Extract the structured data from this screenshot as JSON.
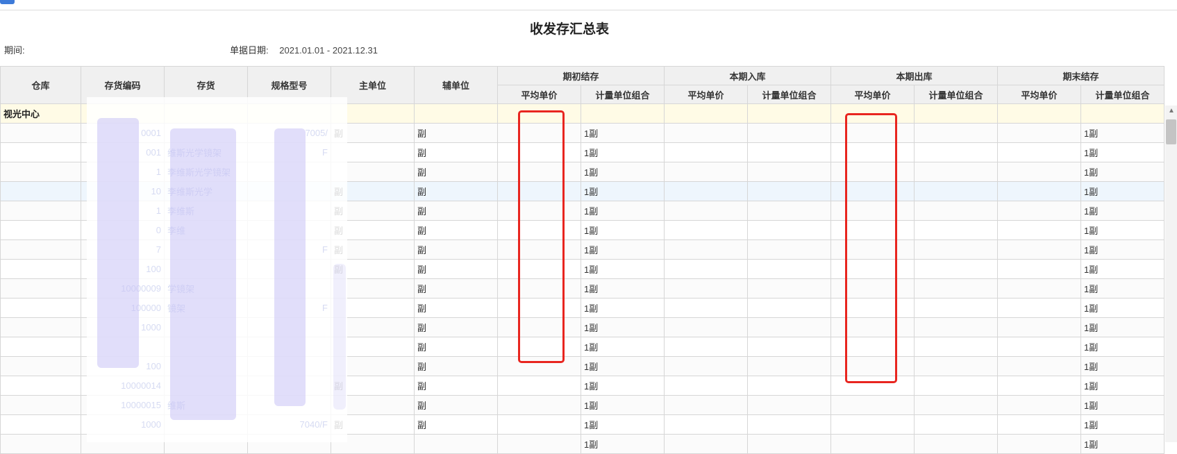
{
  "report": {
    "title": "收发存汇总表",
    "period_label": "期间:",
    "period_value": "",
    "date_label": "单据日期:",
    "date_value": "2021.01.01 - 2021.12.31"
  },
  "columns": {
    "warehouse": "仓库",
    "code": "存货编码",
    "item": "存货",
    "spec": "规格型号",
    "main_unit": "主单位",
    "aux_unit": "辅单位",
    "opening": "期初结存",
    "inbound": "本期入库",
    "outbound": "本期出库",
    "closing": "期末结存",
    "avg_price": "平均单价",
    "unit_combo": "计量单位组合"
  },
  "group_label": "视光中心",
  "rows": [
    {
      "code": "0001",
      "item": "",
      "spec": "7005/",
      "main": "副",
      "aux": "副",
      "open_combo": "1副",
      "close_combo": "1副"
    },
    {
      "code": "001",
      "item": "维斯光学镜架",
      "spec": "F",
      "main": "",
      "aux": "副",
      "open_combo": "1副",
      "close_combo": "1副"
    },
    {
      "code": "1",
      "item": "李维斯光学镜架",
      "spec": "",
      "main": "",
      "aux": "副",
      "open_combo": "1副",
      "close_combo": "1副"
    },
    {
      "code": "10",
      "item": "李维斯光学",
      "spec": "",
      "main": "副",
      "aux": "副",
      "open_combo": "1副",
      "close_combo": "1副"
    },
    {
      "code": "1",
      "item": "李维斯",
      "spec": "",
      "main": "副",
      "aux": "副",
      "open_combo": "1副",
      "close_combo": "1副"
    },
    {
      "code": "0",
      "item": "李维",
      "spec": "",
      "main": "副",
      "aux": "副",
      "open_combo": "1副",
      "close_combo": "1副"
    },
    {
      "code": "7",
      "item": "",
      "spec": "F",
      "main": "副",
      "aux": "副",
      "open_combo": "1副",
      "close_combo": "1副"
    },
    {
      "code": "100",
      "item": "",
      "spec": "",
      "main": "副",
      "aux": "副",
      "open_combo": "1副",
      "close_combo": "1副"
    },
    {
      "code": "10000009",
      "item": "学镜架",
      "spec": "",
      "main": "",
      "aux": "副",
      "open_combo": "1副",
      "close_combo": "1副"
    },
    {
      "code": "100000",
      "item": "镜架",
      "spec": "F",
      "main": "",
      "aux": "副",
      "open_combo": "1副",
      "close_combo": "1副"
    },
    {
      "code": "1000",
      "item": "",
      "spec": "",
      "main": "",
      "aux": "副",
      "open_combo": "1副",
      "close_combo": "1副"
    },
    {
      "code": "",
      "item": "",
      "spec": "",
      "main": "",
      "aux": "副",
      "open_combo": "1副",
      "close_combo": "1副"
    },
    {
      "code": "100",
      "item": "",
      "spec": "",
      "main": "",
      "aux": "副",
      "open_combo": "1副",
      "close_combo": "1副"
    },
    {
      "code": "10000014",
      "item": "",
      "spec": "",
      "main": "副",
      "aux": "副",
      "open_combo": "1副",
      "close_combo": "1副"
    },
    {
      "code": "10000015",
      "item": "维斯",
      "spec": "",
      "main": "",
      "aux": "副",
      "open_combo": "1副",
      "close_combo": "1副"
    },
    {
      "code": "1000",
      "item": "",
      "spec": "7040/F",
      "main": "副",
      "aux": "副",
      "open_combo": "1副",
      "close_combo": "1副"
    },
    {
      "code": "",
      "item": "",
      "spec": "",
      "main": "",
      "aux": "",
      "open_combo": "1副",
      "close_combo": "1副"
    }
  ]
}
